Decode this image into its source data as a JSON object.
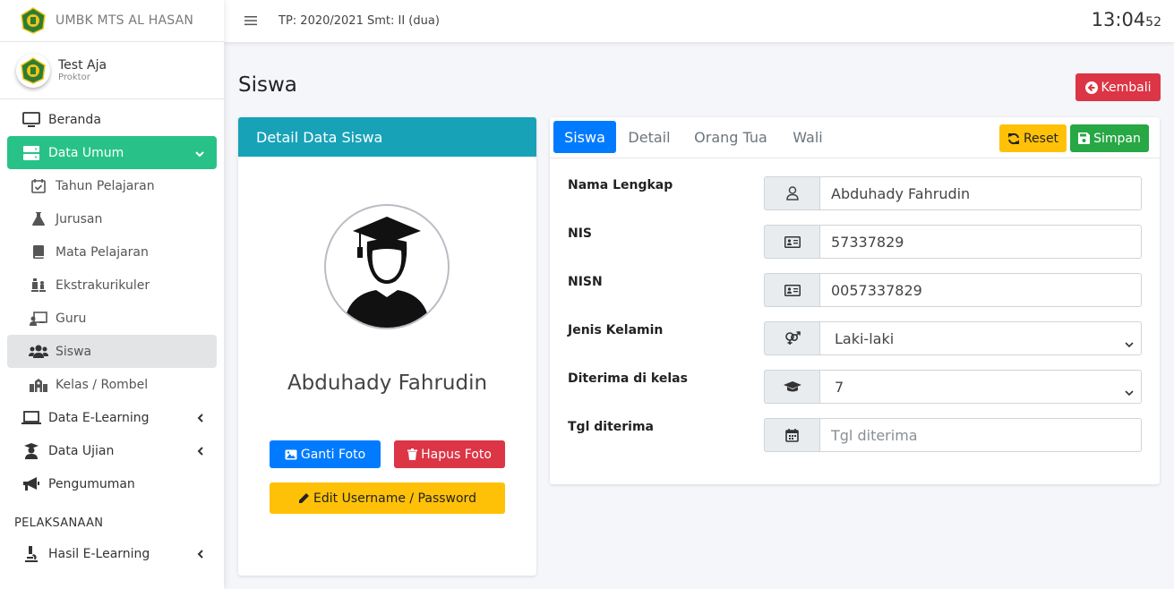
{
  "brand": {
    "name": "UMBK MTS AL HASAN"
  },
  "user": {
    "name": "Test Aja",
    "role": "Proktor"
  },
  "sidebar": {
    "items": [
      {
        "label": "Beranda",
        "icon": "monitor-icon"
      },
      {
        "label": "Data Umum",
        "icon": "server-icon"
      },
      {
        "label": "Tahun Pelajaran",
        "icon": "calendar-check-icon"
      },
      {
        "label": "Jurusan",
        "icon": "flask-icon"
      },
      {
        "label": "Mata Pelajaran",
        "icon": "book-icon"
      },
      {
        "label": "Ekstrakurikuler",
        "icon": "chess-icon"
      },
      {
        "label": "Guru",
        "icon": "chalkboard-teacher-icon"
      },
      {
        "label": "Siswa",
        "icon": "users-icon"
      },
      {
        "label": "Kelas / Rombel",
        "icon": "school-icon"
      },
      {
        "label": "Data E-Learning",
        "icon": "laptop-icon"
      },
      {
        "label": "Data Ujian",
        "icon": "user-graduate-icon"
      },
      {
        "label": "Pengumuman",
        "icon": "bullhorn-icon"
      }
    ],
    "section_header": "PELAKSANAAN",
    "section_items": [
      {
        "label": "Hasil E-Learning",
        "icon": "microscope-icon"
      }
    ]
  },
  "topbar": {
    "tp_text": "TP: 2020/2021 Smt: II (dua)",
    "clock_hm": "13:04",
    "clock_sec": "52"
  },
  "page": {
    "title": "Siswa",
    "back_label": "Kembali"
  },
  "detail_card": {
    "header": "Detail Data Siswa",
    "student_name": "Abduhady Fahrudin",
    "change_photo_label": "Ganti Foto",
    "delete_photo_label": "Hapus Foto",
    "edit_credentials_label": "Edit Username / Password"
  },
  "form_card": {
    "tabs": [
      "Siswa",
      "Detail",
      "Orang Tua",
      "Wali"
    ],
    "active_tab": "Siswa",
    "reset_label": "Reset",
    "save_label": "Simpan",
    "fields": {
      "nama_lengkap": {
        "label": "Nama Lengkap",
        "value": "Abduhady Fahrudin"
      },
      "nis": {
        "label": "NIS",
        "value": "57337829"
      },
      "nisn": {
        "label": "NISN",
        "value": "0057337829"
      },
      "jenis_kelamin": {
        "label": "Jenis Kelamin",
        "value": "Laki-laki"
      },
      "diterima_kelas": {
        "label": "Diterima di kelas",
        "value": "7"
      },
      "tgl_diterima": {
        "label": "Tgl diterima",
        "placeholder": "Tgl diterima"
      }
    }
  },
  "colors": {
    "sidebar_active": "#28c288",
    "card_header": "#17a2b8",
    "primary": "#007bff",
    "danger": "#dc3545",
    "warning": "#ffc107",
    "success": "#28a745"
  }
}
